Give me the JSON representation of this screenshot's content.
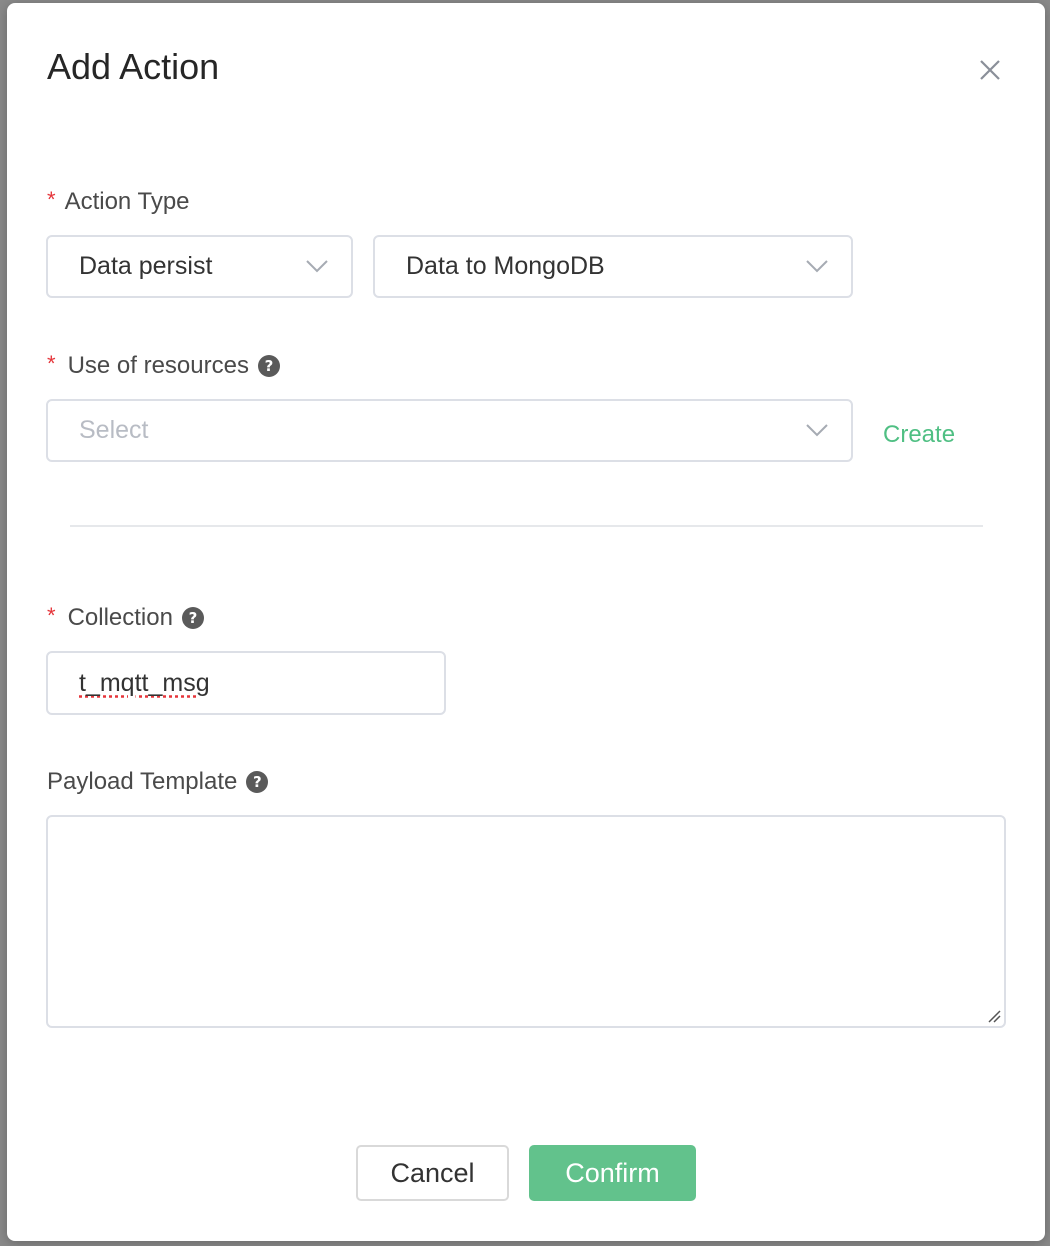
{
  "modal": {
    "title": "Add Action",
    "close_icon": "close-icon"
  },
  "action_type": {
    "label": "Action Type",
    "required_mark": "*",
    "category_value": "Data persist",
    "target_value": "Data to MongoDB"
  },
  "resources": {
    "label": "Use of resources",
    "required_mark": "*",
    "help_icon": "?",
    "placeholder": "Select",
    "create_label": "Create"
  },
  "collection": {
    "label": "Collection",
    "required_mark": "*",
    "help_icon": "?",
    "value": "t_mqtt_msg"
  },
  "payload_template": {
    "label": "Payload Template",
    "help_icon": "?",
    "value": ""
  },
  "footer": {
    "cancel_label": "Cancel",
    "confirm_label": "Confirm"
  },
  "colors": {
    "accent": "#62c28c",
    "link": "#4fbf83",
    "required": "#e5353a"
  }
}
